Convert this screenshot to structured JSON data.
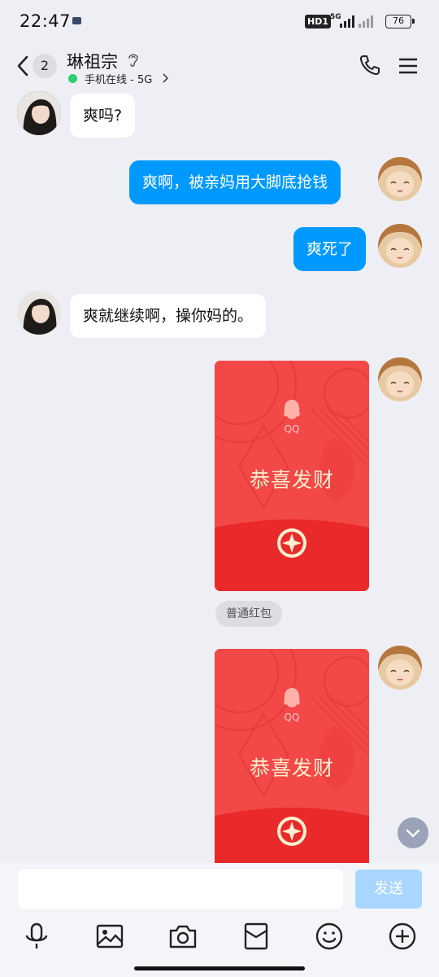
{
  "status_bar": {
    "time": "22:47",
    "hd_label": "HD1",
    "network_label": "5G",
    "battery": "76"
  },
  "header": {
    "unread_count": "2",
    "contact_name": "琳祖宗",
    "online_status": "手机在线 - 5G"
  },
  "messages": [
    {
      "side": "in",
      "text": "爽吗?"
    },
    {
      "side": "out",
      "text": "爽啊，被亲妈用大脚底抢钱"
    },
    {
      "side": "out",
      "text": "爽死了"
    },
    {
      "side": "in",
      "text": "爽就继续啊，操你妈的。"
    }
  ],
  "red_packets": [
    {
      "brand": "QQ",
      "title": "恭喜发财"
    },
    {
      "brand": "QQ",
      "title": "恭喜发财"
    }
  ],
  "red_packet_type_label": "普通红包",
  "input": {
    "value": "",
    "send_label": "发送"
  },
  "toolbar_icons": [
    "microphone-icon",
    "image-icon",
    "camera-icon",
    "red-packet-icon",
    "emoji-icon",
    "plus-icon"
  ],
  "colors": {
    "outgoing_bubble": "#0099ff",
    "incoming_bubble": "#ffffff",
    "background": "#eeeff4",
    "red_packet": "#f24646",
    "send_disabled": "#a9d6ff",
    "online": "#2bcf72"
  }
}
